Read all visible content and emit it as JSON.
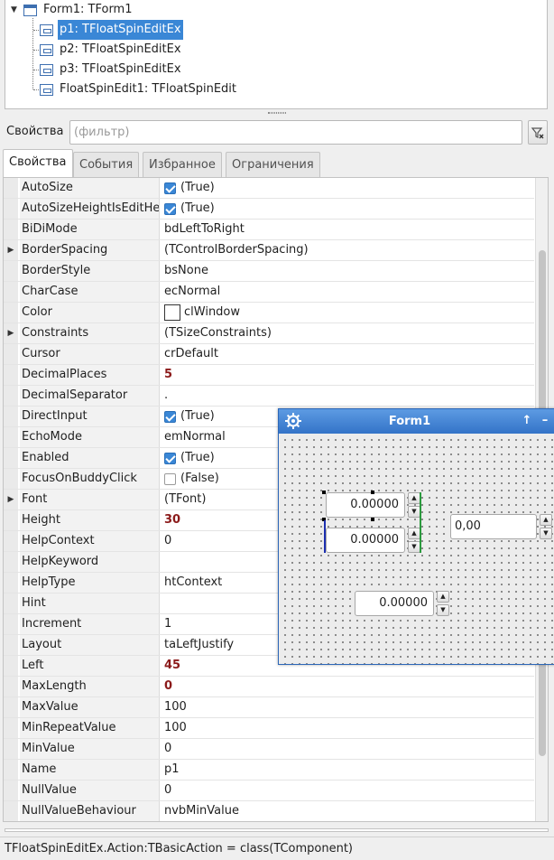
{
  "component_tree": {
    "root": {
      "label": "Form1: TForm1",
      "expander": "expanded"
    },
    "children": [
      {
        "label": "p1: TFloatSpinEditEx",
        "selected": true
      },
      {
        "label": "p2: TFloatSpinEditEx",
        "selected": false
      },
      {
        "label": "p3: TFloatSpinEditEx",
        "selected": false
      },
      {
        "label": "FloatSpinEdit1: TFloatSpinEdit",
        "selected": false
      }
    ]
  },
  "filter": {
    "label": "Свойства",
    "placeholder": "(фильтр)",
    "value": "",
    "clear_icon": "funnel-clear-icon"
  },
  "tabs": [
    {
      "label": "Свойства",
      "active": true
    },
    {
      "label": "События",
      "active": false
    },
    {
      "label": "Избранное",
      "active": false
    },
    {
      "label": "Ограничения",
      "active": false
    }
  ],
  "properties": [
    {
      "name": "AutoSize",
      "value": "(True)",
      "checkbox": "on"
    },
    {
      "name": "AutoSizeHeightIsEditHeight",
      "value": "(True)",
      "checkbox": "on"
    },
    {
      "name": "BiDiMode",
      "value": "bdLeftToRight"
    },
    {
      "name": "BorderSpacing",
      "value": "(TControlBorderSpacing)",
      "expandable": true
    },
    {
      "name": "BorderStyle",
      "value": "bsNone"
    },
    {
      "name": "CharCase",
      "value": "ecNormal"
    },
    {
      "name": "Color",
      "value": "clWindow",
      "swatch": "#ffffff"
    },
    {
      "name": "Constraints",
      "value": "(TSizeConstraints)",
      "expandable": true
    },
    {
      "name": "Cursor",
      "value": "crDefault"
    },
    {
      "name": "DecimalPlaces",
      "value": "5",
      "changed": true
    },
    {
      "name": "DecimalSeparator",
      "value": "."
    },
    {
      "name": "DirectInput",
      "value": "(True)",
      "checkbox": "on"
    },
    {
      "name": "EchoMode",
      "value": "emNormal"
    },
    {
      "name": "Enabled",
      "value": "(True)",
      "checkbox": "on"
    },
    {
      "name": "FocusOnBuddyClick",
      "value": "(False)",
      "checkbox": "off"
    },
    {
      "name": "Font",
      "value": "(TFont)",
      "expandable": true
    },
    {
      "name": "Height",
      "value": "30",
      "changed": true
    },
    {
      "name": "HelpContext",
      "value": "0"
    },
    {
      "name": "HelpKeyword",
      "value": ""
    },
    {
      "name": "HelpType",
      "value": "htContext"
    },
    {
      "name": "Hint",
      "value": ""
    },
    {
      "name": "Increment",
      "value": "1"
    },
    {
      "name": "Layout",
      "value": "taLeftJustify"
    },
    {
      "name": "Left",
      "value": "45",
      "changed": true
    },
    {
      "name": "MaxLength",
      "value": "0",
      "changed": true
    },
    {
      "name": "MaxValue",
      "value": "100"
    },
    {
      "name": "MinRepeatValue",
      "value": "100"
    },
    {
      "name": "MinValue",
      "value": "0"
    },
    {
      "name": "Name",
      "value": "p1"
    },
    {
      "name": "NullValue",
      "value": "0"
    },
    {
      "name": "NullValueBehaviour",
      "value": "nvbMinValue"
    }
  ],
  "status_bar": "TFloatSpinEditEx.Action:TBasicAction = class(TComponent)",
  "form_window": {
    "title": "Form1",
    "app_icon": "gear-icon",
    "pin_icon": "↑",
    "minimize_icon": "–",
    "spin_edits": [
      {
        "name": "p1",
        "value": "0.00000",
        "selected": true
      },
      {
        "name": "p2",
        "value": "0.00000",
        "selected": false
      },
      {
        "name": "p3",
        "value": "0.00000",
        "selected": false
      },
      {
        "name": "FloatSpinEdit1",
        "value": "0,00",
        "selected": false
      }
    ],
    "arrow_up": "▲",
    "arrow_down": "▼"
  },
  "colors": {
    "selection": "#3a87d6",
    "changed_value": "#8b1a1a",
    "titlebar": "#3373c8"
  }
}
